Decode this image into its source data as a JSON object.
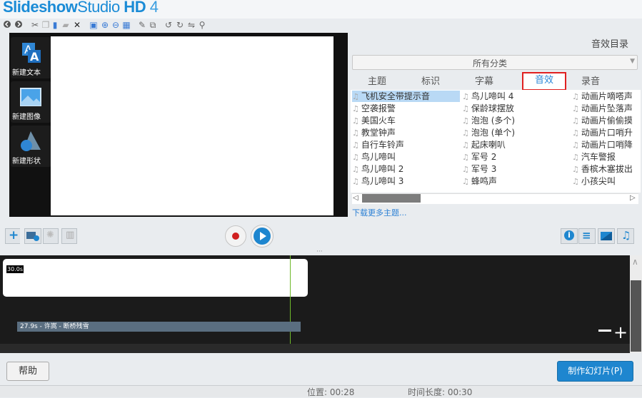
{
  "app": {
    "name_a": "Slideshow",
    "name_b": "Studio",
    "name_c": " HD",
    "name_d": " 4"
  },
  "toolbar": {
    "icons": [
      "back-icon",
      "forward-icon",
      "cut-icon",
      "copy-icon",
      "paste-icon",
      "stretch-icon",
      "delete-icon",
      "zoom-fit-icon",
      "zoom-in-icon",
      "zoom-out-icon",
      "zoom-select-icon",
      "edit-icon",
      "crop-icon",
      "rotate-left-icon",
      "rotate-right-icon",
      "flip-icon",
      "pin-icon"
    ]
  },
  "new_items": [
    {
      "label": "新建文本",
      "icon": "new-text-icon"
    },
    {
      "label": "新建图像",
      "icon": "new-image-icon"
    },
    {
      "label": "新建形状",
      "icon": "new-shape-icon"
    }
  ],
  "catalog": {
    "title": "音效目录",
    "category": "所有分类",
    "tabs": [
      "主题",
      "标识",
      "字幕",
      "音效",
      "录音"
    ],
    "active_tab": "音效"
  },
  "sounds": {
    "col1": [
      "飞机安全带提示音",
      "空袭报警",
      "美国火车",
      "教堂钟声",
      "自行车铃声",
      "鸟儿啼叫",
      "鸟儿啼叫 2",
      "鸟儿啼叫 3"
    ],
    "col2": [
      "鸟儿啼叫 4",
      "保龄球摆放",
      "泡泡 (多个)",
      "泡泡 (单个)",
      "起床喇叭",
      "军号 2",
      "军号 3",
      "蜂鸣声"
    ],
    "col3": [
      "动画片嘀嗒声",
      "动画片坠落声",
      "动画片偷偷摸",
      "动画片口哨升",
      "动画片口哨降",
      "汽车警报",
      "香槟木塞拔出",
      "小孩尖叫"
    ],
    "selected": "飞机安全带提示音"
  },
  "download_more": "下载更多主题...",
  "timeline": {
    "slide_duration": "30.0s",
    "audio_label": "27.9s - 许嵩 - 断桥残雪"
  },
  "bottom": {
    "help": "帮助",
    "make": "制作幻灯片(P)"
  },
  "status": {
    "position": "位置: 00:28",
    "duration": "时间长度: 00:30"
  },
  "colors": {
    "accent": "#1e86cf",
    "tab_highlight": "#e02020",
    "playhead": "#6fba2b"
  }
}
